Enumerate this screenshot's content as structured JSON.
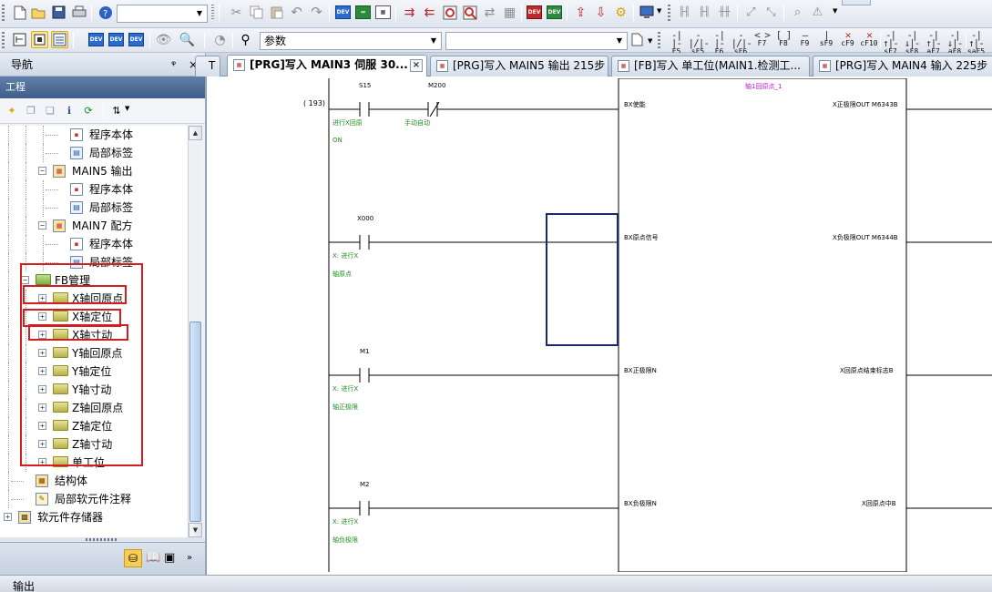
{
  "toolbar1": {
    "combo_value": "",
    "search_label": "搜索",
    "icons": [
      "new-file-icon",
      "open-folder-icon",
      "save-icon",
      "print-icon",
      "help-icon",
      "cut-icon",
      "copy-icon",
      "paste-icon",
      "undo-icon",
      "redo-icon",
      "device-search-icon",
      "device-replace-icon",
      "device-batch-icon",
      "write-to-plc-icon",
      "read-from-plc-icon",
      "verify-icon",
      "monitor-icon",
      "stop-monitor-icon",
      "online-icon",
      "device-test-icon",
      "device-batch-test-icon",
      "import-icon",
      "export-icon",
      "settings-icon",
      "display-icon",
      "ladder-contact-icon",
      "ladder-coil-icon",
      "ladder-ins-icon",
      "ladder-del-icon",
      "ladder-jump-icon",
      "zoom-icon",
      "find-icon"
    ]
  },
  "toolbar2": {
    "param_combo": "参数",
    "second_combo": "",
    "fkeys": [
      {
        "glyph": "-|  |-",
        "label": "F5"
      },
      {
        "glyph": "-|/|-",
        "label": "sF5"
      },
      {
        "glyph": "-|  |-",
        "label": "F6"
      },
      {
        "glyph": "-|/|-",
        "label": "sF6"
      },
      {
        "glyph": "< >",
        "label": "F7"
      },
      {
        "glyph": "[ ]",
        "label": "F8"
      },
      {
        "glyph": "—",
        "label": "F9"
      },
      {
        "glyph": "|",
        "label": "sF9"
      },
      {
        "glyph": "✕",
        "label": "cF9"
      },
      {
        "glyph": "✕",
        "label": "cF10"
      },
      {
        "glyph": "-|↑|-",
        "label": "sF7"
      },
      {
        "glyph": "-|↓|-",
        "label": "sF8"
      },
      {
        "glyph": "-|↑|-",
        "label": "aF7"
      },
      {
        "glyph": "-|↓|-",
        "label": "aF8"
      },
      {
        "glyph": "-|↑|-",
        "label": "saF5"
      }
    ]
  },
  "nav": {
    "title": "导航",
    "pin": "ᵠ",
    "close": "×",
    "project_header": "工程",
    "tree": [
      {
        "label": "程序本体",
        "level": 3,
        "icon": "program-icon",
        "expander": ""
      },
      {
        "label": "局部标签",
        "level": 3,
        "icon": "label-icon",
        "expander": ""
      },
      {
        "label": "MAIN5 输出",
        "level": 2,
        "icon": "program-file-icon",
        "expander": "−"
      },
      {
        "label": "程序本体",
        "level": 3,
        "icon": "program-icon",
        "expander": ""
      },
      {
        "label": "局部标签",
        "level": 3,
        "icon": "label-icon",
        "expander": ""
      },
      {
        "label": "MAIN7 配方",
        "level": 2,
        "icon": "program-file-icon",
        "expander": "−"
      },
      {
        "label": "程序本体",
        "level": 3,
        "icon": "program-icon",
        "expander": ""
      },
      {
        "label": "局部标签",
        "level": 3,
        "icon": "label-icon",
        "expander": ""
      },
      {
        "label": "FB管理",
        "level": 1,
        "icon": "fb-folder-icon",
        "expander": "−"
      },
      {
        "label": "X轴回原点",
        "level": 2,
        "icon": "folder-icon",
        "expander": "+"
      },
      {
        "label": "X轴定位",
        "level": 2,
        "icon": "folder-icon",
        "expander": "+"
      },
      {
        "label": "X轴寸动",
        "level": 2,
        "icon": "folder-icon",
        "expander": "+"
      },
      {
        "label": "Y轴回原点",
        "level": 2,
        "icon": "folder-icon",
        "expander": "+"
      },
      {
        "label": "Y轴定位",
        "level": 2,
        "icon": "folder-icon",
        "expander": "+"
      },
      {
        "label": "Y轴寸动",
        "level": 2,
        "icon": "folder-icon",
        "expander": "+"
      },
      {
        "label": "Z轴回原点",
        "level": 2,
        "icon": "folder-icon",
        "expander": "+"
      },
      {
        "label": "Z轴定位",
        "level": 2,
        "icon": "folder-icon",
        "expander": "+"
      },
      {
        "label": "Z轴寸动",
        "level": 2,
        "icon": "folder-icon",
        "expander": "+"
      },
      {
        "label": "单工位",
        "level": 2,
        "icon": "folder-icon",
        "expander": "+"
      },
      {
        "label": "结构体",
        "level": 1,
        "icon": "struct-icon",
        "expander": ""
      },
      {
        "label": "局部软元件注释",
        "level": 1,
        "icon": "comment-icon",
        "expander": ""
      },
      {
        "label": "软元件存储器",
        "level": 0,
        "icon": "device-memory-icon",
        "expander": "+"
      }
    ]
  },
  "tabs": [
    {
      "label": "T",
      "active": false,
      "icon": false,
      "close": false
    },
    {
      "label": "[PRG]写入 MAIN3 伺服 30...",
      "active": true,
      "icon": true,
      "close": true
    },
    {
      "label": "[PRG]写入 MAIN5 输出 215步",
      "active": false,
      "icon": true,
      "close": false
    },
    {
      "label": "[FB]写入 单工位(MAIN1.检测工...",
      "active": false,
      "icon": true,
      "close": false
    },
    {
      "label": "[PRG]写入 MAIN4 输入 225步",
      "active": false,
      "icon": true,
      "close": false
    }
  ],
  "ladder": {
    "step": "( 193)",
    "fb_instance": "轴1回原点_1",
    "rungs": [
      {
        "contact1": "S15",
        "contact1_comments": [
          "进行X回原",
          "ON"
        ],
        "contact2": "M200",
        "contact2_comments": [
          "手动自动"
        ],
        "in_label": "BX使能",
        "out_label": "X正极限OUT M6343B"
      },
      {
        "contact1": "X000",
        "contact1_comments": [
          "X: 进行X",
          "轴原点"
        ],
        "in_label": "BX原点信号",
        "out_label": "X负极限OUT M6344B"
      },
      {
        "contact1": "M1",
        "contact1_comments": [
          "X: 进行X",
          "轴正极限"
        ],
        "in_label": "BX正极限N",
        "out_label": "X回原点结束标志B"
      },
      {
        "contact1": "M2",
        "contact1_comments": [
          "X: 进行X",
          "轴负极限"
        ],
        "in_label": "BX负极限N",
        "out_label": "X回原点中B"
      }
    ]
  },
  "status": {
    "output_label": "输出"
  },
  "colors": {
    "highlight": "#d21e1e",
    "ladder_line": "#000000",
    "comment_green": "#1f8f1f",
    "fb_name_purple": "#c21ad6",
    "selection_box": "#1a2a6e"
  }
}
